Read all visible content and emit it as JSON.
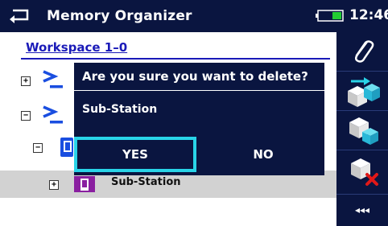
{
  "header": {
    "title": "Memory Organizer",
    "time": "12:46"
  },
  "tree": {
    "workspace_label": "Workspace 1–0",
    "toggles": [
      "+",
      "−",
      "−",
      "+"
    ],
    "selected_node_label": "Sub-Station"
  },
  "dialog": {
    "question": "Are you sure you want to delete?",
    "item": "Sub-Station",
    "yes_label": "YES",
    "no_label": "NO"
  },
  "sidebar": {
    "more_label": "◂◂◂"
  },
  "colors": {
    "header_bg": "#0a1540",
    "accent_cyan": "#29d4e8",
    "workspace_blue": "#1a1ab8",
    "battery_green": "#22cc33",
    "delete_red": "#e01818",
    "node_purple": "#8a1fa0"
  }
}
